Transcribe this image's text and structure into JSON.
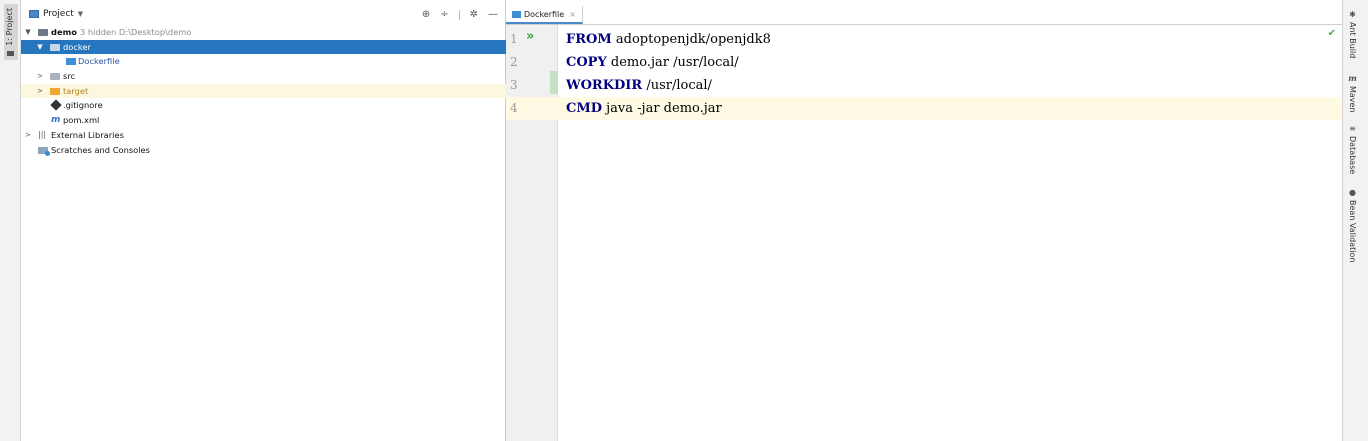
{
  "left_strip": {
    "tab_label": "1: Project"
  },
  "project_panel": {
    "title": "Project",
    "tree": {
      "root": {
        "name": "demo",
        "hint": "3 hidden  D:\\Desktop\\demo"
      },
      "docker": "docker",
      "dockerfile": "Dockerfile",
      "src": "src",
      "target": "target",
      "gitignore": ".gitignore",
      "pom": "pom.xml",
      "libraries": "External Libraries",
      "scratches": "Scratches and Consoles"
    }
  },
  "editor": {
    "tab_label": "Dockerfile",
    "lines": [
      {
        "num": "1",
        "kw": "FROM",
        "rest": " adoptopenjdk/openjdk8"
      },
      {
        "num": "2",
        "kw": "COPY",
        "rest": " demo.jar /usr/local/"
      },
      {
        "num": "3",
        "kw": "WORKDIR",
        "rest": " /usr/local/"
      },
      {
        "num": "4",
        "kw": "CMD",
        "rest": " java -jar demo.jar"
      }
    ]
  },
  "right_strip": {
    "ant": "Ant Build",
    "maven": "Maven",
    "database": "Database",
    "bean": "Bean Validation"
  },
  "icons": {
    "run": "run-gutter-icon",
    "check": "inspection-ok-icon"
  },
  "colors": {
    "selection": "#2675bf",
    "keyword": "#000080",
    "current_line": "#fffae3"
  }
}
